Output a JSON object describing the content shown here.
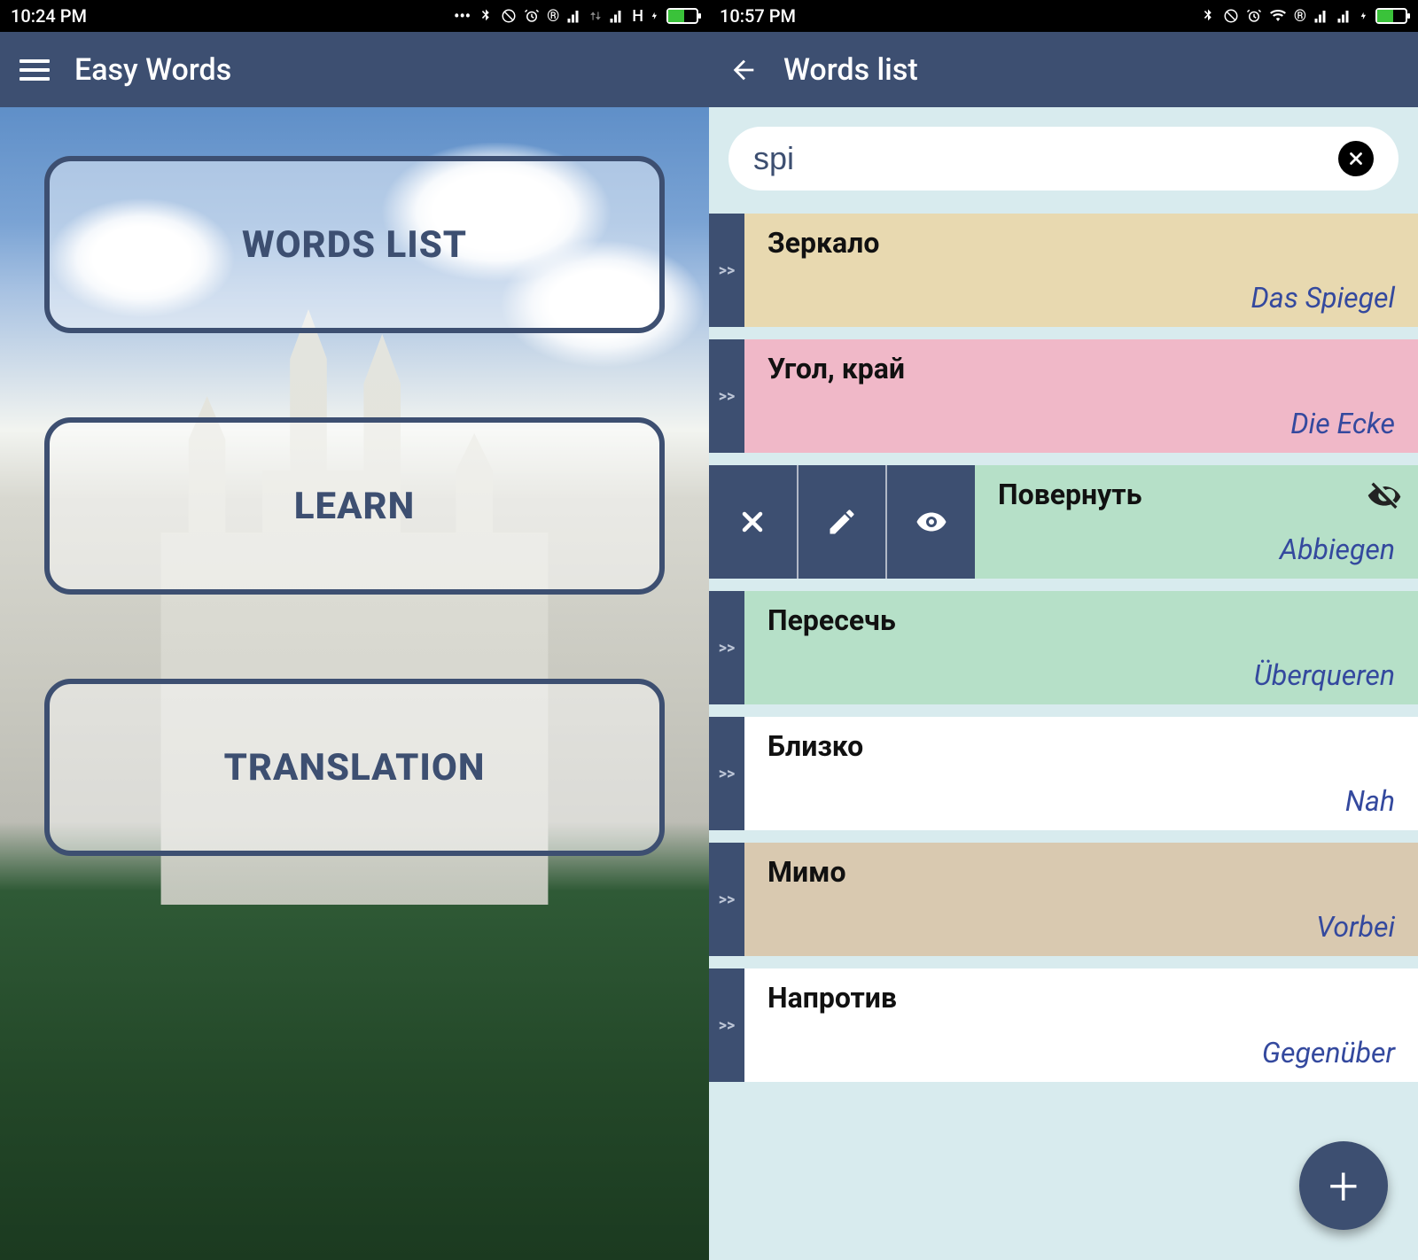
{
  "left": {
    "status": {
      "time": "10:24 PM",
      "net": "H"
    },
    "appTitle": "Easy Words",
    "menu": {
      "wordsList": "WORDS LIST",
      "learn": "LEARN",
      "translation": "TRANSLATION"
    }
  },
  "right": {
    "status": {
      "time": "10:57 PM"
    },
    "appTitle": "Words list",
    "search": {
      "value": "spi"
    },
    "handle": ">>",
    "rows": [
      {
        "src": "Зеркало",
        "dst": "Das Spiegel",
        "bg": "bg-tan",
        "swiped": false
      },
      {
        "src": "Угол, край",
        "dst": "Die Ecke",
        "bg": "bg-pink",
        "swiped": false
      },
      {
        "src": "Повернуть",
        "dst": "Abbiegen",
        "bg": "bg-mint",
        "swiped": true
      },
      {
        "src": "Пересечь",
        "dst": "Überqueren",
        "bg": "bg-mint",
        "swiped": false
      },
      {
        "src": "Близко",
        "dst": "Nah",
        "bg": "bg-white",
        "swiped": false
      },
      {
        "src": "Мимо",
        "dst": "Vorbei",
        "bg": "bg-beige",
        "swiped": false
      },
      {
        "src": "Напротив",
        "dst": "Gegenüber",
        "bg": "bg-white",
        "swiped": false
      }
    ],
    "fab": "+"
  }
}
